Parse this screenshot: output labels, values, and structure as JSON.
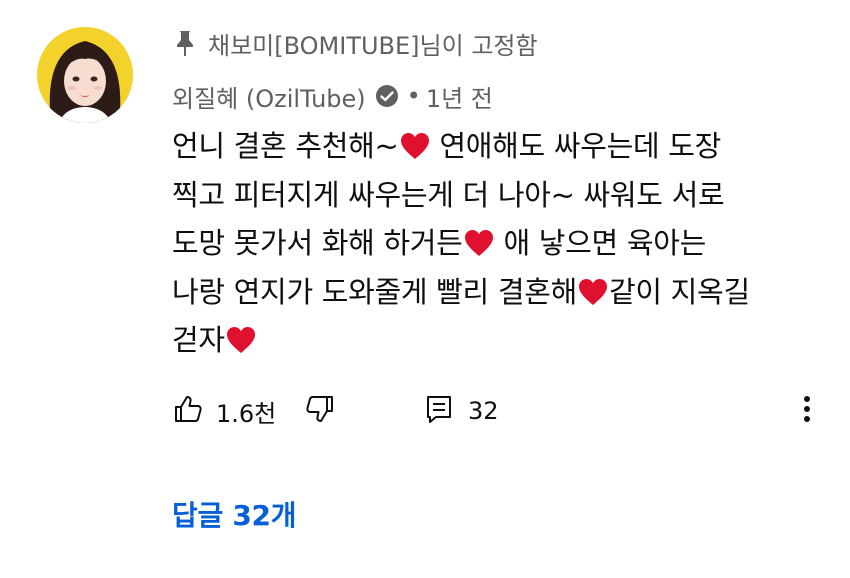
{
  "pinned": {
    "text": "채보미[BOMITUBE]님이 고정함",
    "icon": "pin-icon"
  },
  "author": {
    "name": "외질혜 (OzilTube)",
    "verified_icon": "verified-check-icon",
    "separator": "•",
    "time": "1년 전"
  },
  "comment": {
    "segments": [
      "언니 결혼 추천해~",
      "연애해도 싸우는데 도장",
      "찍고 피터지게 싸우는게 더 나아~ 싸워도 서로",
      "도망 못가서 화해 하거든",
      "애 낳으면 육아는",
      "나랑 연지가 도와줄게 빨리 결혼해",
      "같이 지옥길",
      "걷자"
    ],
    "heart_color": "#e0102f"
  },
  "actions": {
    "like_count": "1.6천",
    "reply_count": "32",
    "like_icon": "thumb-up-icon",
    "dislike_icon": "thumb-down-icon",
    "reply_icon": "comment-icon",
    "more_icon": "more-vert-icon"
  },
  "replies_label": "답글 32개",
  "colors": {
    "secondary_text": "#606060",
    "primary_text": "#0f0f0f",
    "link_blue": "#065fd4",
    "avatar_bg": "#f5d31b"
  }
}
